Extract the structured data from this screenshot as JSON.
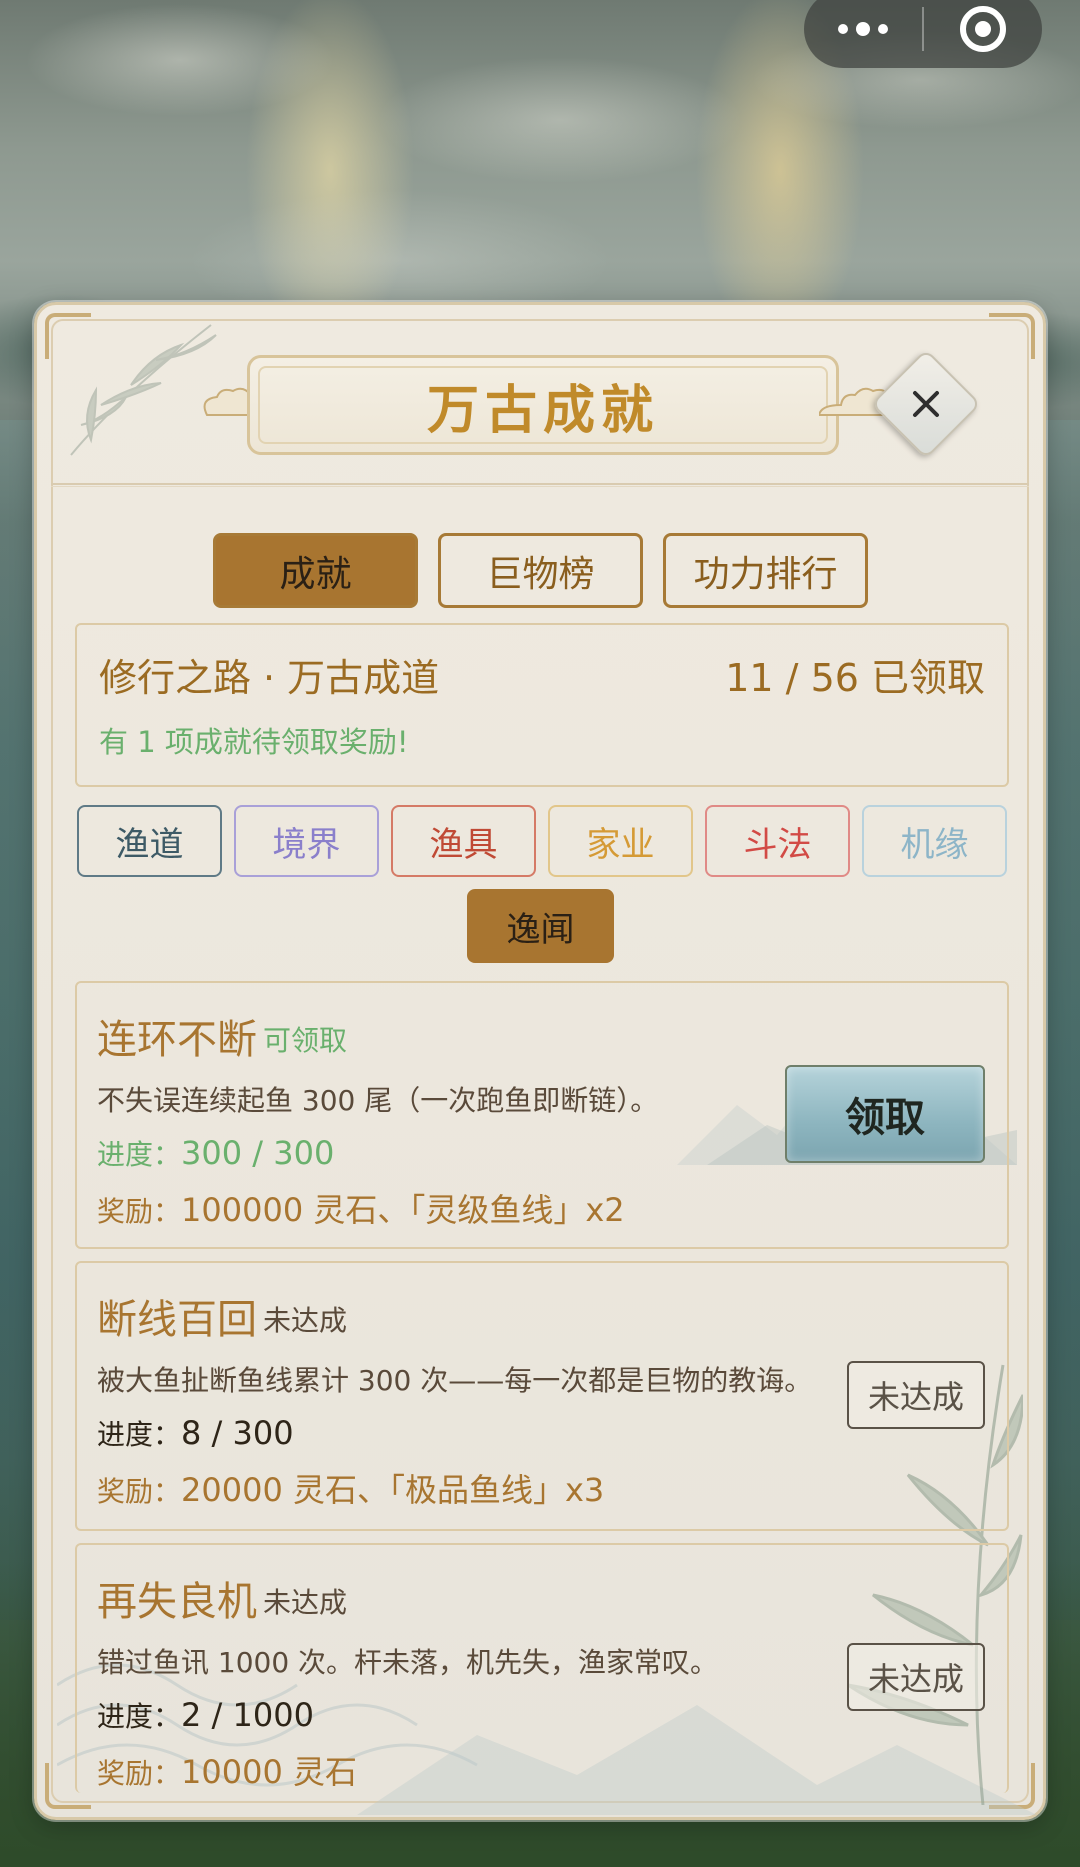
{
  "capsule": {
    "more_icon": "more-dots-icon",
    "close_icon": "target-icon"
  },
  "header": {
    "title": "万古成就",
    "close_icon": "close-icon"
  },
  "tabs": [
    {
      "label": "成就",
      "active": true
    },
    {
      "label": "巨物榜",
      "active": false
    },
    {
      "label": "功力排行",
      "active": false
    }
  ],
  "summary": {
    "path_name": "修行之路",
    "separator": "·",
    "path_stage": "万古成道",
    "claimed": "11 / 56 已领取",
    "notice": "有 1 项成就待领取奖励!"
  },
  "categories": [
    {
      "label": "渔道",
      "color": "#3d5a66"
    },
    {
      "label": "境界",
      "color": "#8a7fcb"
    },
    {
      "label": "渔具",
      "color": "#c04a35"
    },
    {
      "label": "家业",
      "color": "#d59a35"
    },
    {
      "label": "斗法",
      "color": "#d24a45"
    },
    {
      "label": "机缘",
      "color": "#8db5c8"
    },
    {
      "label": "逸闻",
      "active": true
    }
  ],
  "achievements": [
    {
      "name": "连环不断",
      "state": "可领取",
      "state_color": "#6ab06d",
      "description": "不失误连续起鱼 300 尾（一次跑鱼即断链）。",
      "progress_label": "进度：",
      "progress_value": "300 / 300",
      "progress_color": "#6ab06d",
      "reward_label": "奖励：",
      "reward_value": "100000 灵石、「灵级鱼线」x2",
      "reward_color": "#a87530",
      "button": "领取"
    },
    {
      "name": "断线百回",
      "state": "未达成",
      "state_color": "#5a4a3a",
      "description": "被大鱼扯断鱼线累计 300 次——每一次都是巨物的教诲。",
      "progress_label": "进度：",
      "progress_value": "8 / 300",
      "progress_color": "#2e2518",
      "reward_label": "奖励：",
      "reward_value": "20000 灵石、「极品鱼线」x3",
      "reward_color": "#a87530",
      "button": "未达成"
    },
    {
      "name": "再失良机",
      "state": "未达成",
      "state_color": "#5a4a3a",
      "description": "错过鱼讯 1000 次。杆未落，机先失，渔家常叹。",
      "progress_label": "进度：",
      "progress_value": "2 / 1000",
      "progress_color": "#2e2518",
      "reward_label": "奖励：",
      "reward_value": "10000 灵石",
      "reward_color": "#a87530",
      "button": "未达成"
    }
  ]
}
